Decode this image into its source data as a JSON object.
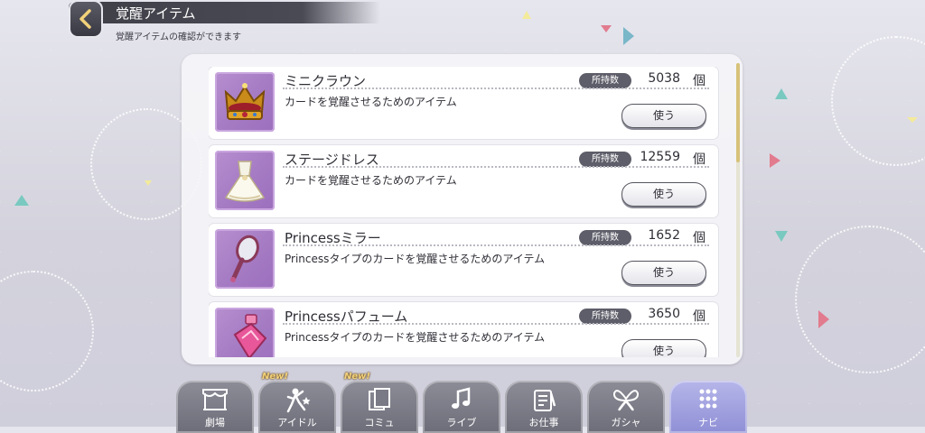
{
  "header": {
    "title": "覚醒アイテム",
    "subtitle": "覚醒アイテムの確認ができます"
  },
  "items": [
    {
      "name": "ミニクラウン",
      "description": "カードを覚醒させるためのアイテム",
      "count_label": "所持数",
      "count": "5038",
      "unit": "個",
      "button": "使う",
      "icon": "crown-icon"
    },
    {
      "name": "ステージドレス",
      "description": "カードを覚醒させるためのアイテム",
      "count_label": "所持数",
      "count": "12559",
      "unit": "個",
      "button": "使う",
      "icon": "dress-icon"
    },
    {
      "name": "Princessミラー",
      "description": "Princessタイプのカードを覚醒させるためのアイテム",
      "count_label": "所持数",
      "count": "1652",
      "unit": "個",
      "button": "使う",
      "icon": "mirror-icon"
    },
    {
      "name": "Princessパフューム",
      "description": "Princessタイプのカードを覚醒させるためのアイテム",
      "count_label": "所持数",
      "count": "3650",
      "unit": "個",
      "button": "使う",
      "icon": "perfume-icon"
    }
  ],
  "nav": {
    "new_badge": "New!",
    "tabs": [
      {
        "label": "劇場",
        "icon": "theater-icon"
      },
      {
        "label": "アイドル",
        "icon": "idol-icon"
      },
      {
        "label": "コミュ",
        "icon": "commu-icon"
      },
      {
        "label": "ライブ",
        "icon": "live-icon"
      },
      {
        "label": "お仕事",
        "icon": "work-icon"
      },
      {
        "label": "ガシャ",
        "icon": "gacha-icon"
      },
      {
        "label": "ナビ",
        "icon": "navi-icon"
      }
    ]
  },
  "colors": {
    "accent_gold": "#d7c27a",
    "thumb_purple": "#a67cc4",
    "nav_gray": "#6d6d79"
  }
}
